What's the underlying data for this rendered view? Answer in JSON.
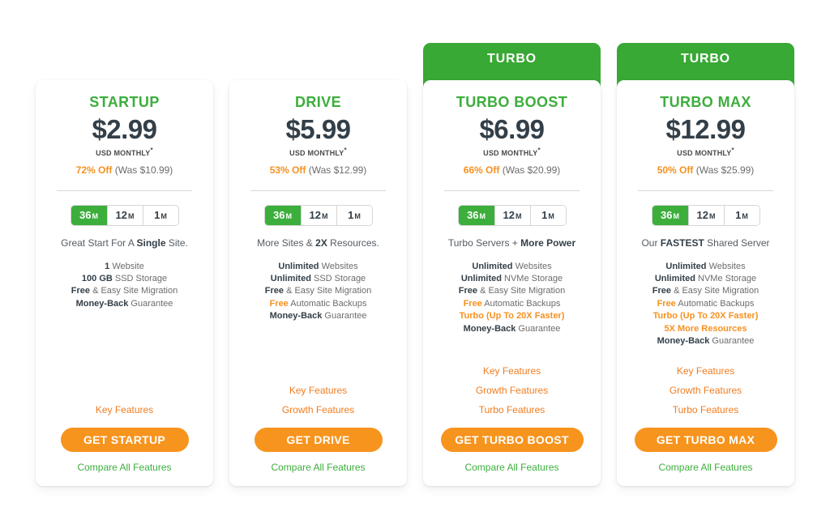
{
  "plans": [
    {
      "banner": null,
      "name": "STARTUP",
      "price": "$2.99",
      "per_term": "USD MONTHLY",
      "per_term_star": "*",
      "discount_pct": "72% Off",
      "discount_was": "(Was $10.99)",
      "terms": [
        {
          "value": "36",
          "unit": "M",
          "selected": true
        },
        {
          "value": "12",
          "unit": "M",
          "selected": false
        },
        {
          "value": "1",
          "unit": "M",
          "selected": false
        }
      ],
      "tagline_pre": "Great Start For A ",
      "tagline_bold": "Single",
      "tagline_post": " Site.",
      "features": [
        {
          "bold": "1",
          "rest": " Website",
          "style": "normal"
        },
        {
          "bold": "100 GB",
          "rest": " SSD Storage",
          "style": "normal"
        },
        {
          "bold": "Free",
          "rest": " & Easy Site Migration",
          "style": "normal"
        },
        {
          "bold": "Money-Back",
          "rest": " Guarantee",
          "style": "normal"
        }
      ],
      "feature_links": [
        "Key Features"
      ],
      "cta_label": "GET STARTUP",
      "compare_label": "Compare All Features"
    },
    {
      "banner": null,
      "name": "DRIVE",
      "price": "$5.99",
      "per_term": "USD MONTHLY",
      "per_term_star": "*",
      "discount_pct": "53% Off",
      "discount_was": "(Was $12.99)",
      "terms": [
        {
          "value": "36",
          "unit": "M",
          "selected": true
        },
        {
          "value": "12",
          "unit": "M",
          "selected": false
        },
        {
          "value": "1",
          "unit": "M",
          "selected": false
        }
      ],
      "tagline_pre": "More Sites & ",
      "tagline_bold": "2X",
      "tagline_post": " Resources.",
      "features": [
        {
          "bold": "Unlimited",
          "rest": " Websites",
          "style": "normal"
        },
        {
          "bold": "Unlimited",
          "rest": " SSD Storage",
          "style": "normal"
        },
        {
          "bold": "Free",
          "rest": " & Easy Site Migration",
          "style": "normal"
        },
        {
          "bold": "Free",
          "rest": " Automatic Backups",
          "style": "orange-bold-lead"
        },
        {
          "bold": "Money-Back",
          "rest": " Guarantee",
          "style": "normal"
        }
      ],
      "feature_links": [
        "Key Features",
        "Growth Features"
      ],
      "cta_label": "GET DRIVE",
      "compare_label": "Compare All Features"
    },
    {
      "banner": "TURBO",
      "name": "TURBO BOOST",
      "price": "$6.99",
      "per_term": "USD MONTHLY",
      "per_term_star": "*",
      "discount_pct": "66% Off",
      "discount_was": "(Was $20.99)",
      "terms": [
        {
          "value": "36",
          "unit": "M",
          "selected": true
        },
        {
          "value": "12",
          "unit": "M",
          "selected": false
        },
        {
          "value": "1",
          "unit": "M",
          "selected": false
        }
      ],
      "tagline_pre": "Turbo Servers + ",
      "tagline_bold": "More Power",
      "tagline_post": "",
      "features": [
        {
          "bold": "Unlimited",
          "rest": " Websites",
          "style": "normal"
        },
        {
          "bold": "Unlimited",
          "rest": " NVMe Storage",
          "style": "normal"
        },
        {
          "bold": "Free",
          "rest": " & Easy Site Migration",
          "style": "normal"
        },
        {
          "bold": "Free",
          "rest": " Automatic Backups",
          "style": "orange-bold-lead"
        },
        {
          "bold": "",
          "rest": "Turbo (Up To 20X Faster)",
          "style": "highlight"
        },
        {
          "bold": "Money-Back",
          "rest": " Guarantee",
          "style": "normal"
        }
      ],
      "feature_links": [
        "Key Features",
        "Growth Features",
        "Turbo Features"
      ],
      "cta_label": "GET TURBO BOOST",
      "compare_label": "Compare All Features"
    },
    {
      "banner": "TURBO",
      "name": "TURBO MAX",
      "price": "$12.99",
      "per_term": "USD MONTHLY",
      "per_term_star": "*",
      "discount_pct": "50% Off",
      "discount_was": "(Was $25.99)",
      "terms": [
        {
          "value": "36",
          "unit": "M",
          "selected": true
        },
        {
          "value": "12",
          "unit": "M",
          "selected": false
        },
        {
          "value": "1",
          "unit": "M",
          "selected": false
        }
      ],
      "tagline_pre": "Our ",
      "tagline_bold": "FASTEST",
      "tagline_post": " Shared Server",
      "features": [
        {
          "bold": "Unlimited",
          "rest": " Websites",
          "style": "normal"
        },
        {
          "bold": "Unlimited",
          "rest": " NVMe Storage",
          "style": "normal"
        },
        {
          "bold": "Free",
          "rest": " & Easy Site Migration",
          "style": "normal"
        },
        {
          "bold": "Free",
          "rest": " Automatic Backups",
          "style": "orange-bold-lead"
        },
        {
          "bold": "",
          "rest": "Turbo (Up To 20X Faster)",
          "style": "highlight"
        },
        {
          "bold": "",
          "rest": "5X More Resources",
          "style": "highlight"
        },
        {
          "bold": "Money-Back",
          "rest": " Guarantee",
          "style": "normal"
        }
      ],
      "feature_links": [
        "Key Features",
        "Growth Features",
        "Turbo Features"
      ],
      "cta_label": "GET TURBO MAX",
      "compare_label": "Compare All Features"
    }
  ],
  "colors": {
    "green": "#3cae3c",
    "banner_green": "#39a935",
    "orange": "#f7941e",
    "link_orange": "#f07d22",
    "price_dark": "#333f48",
    "muted": "#6c6c6c"
  }
}
